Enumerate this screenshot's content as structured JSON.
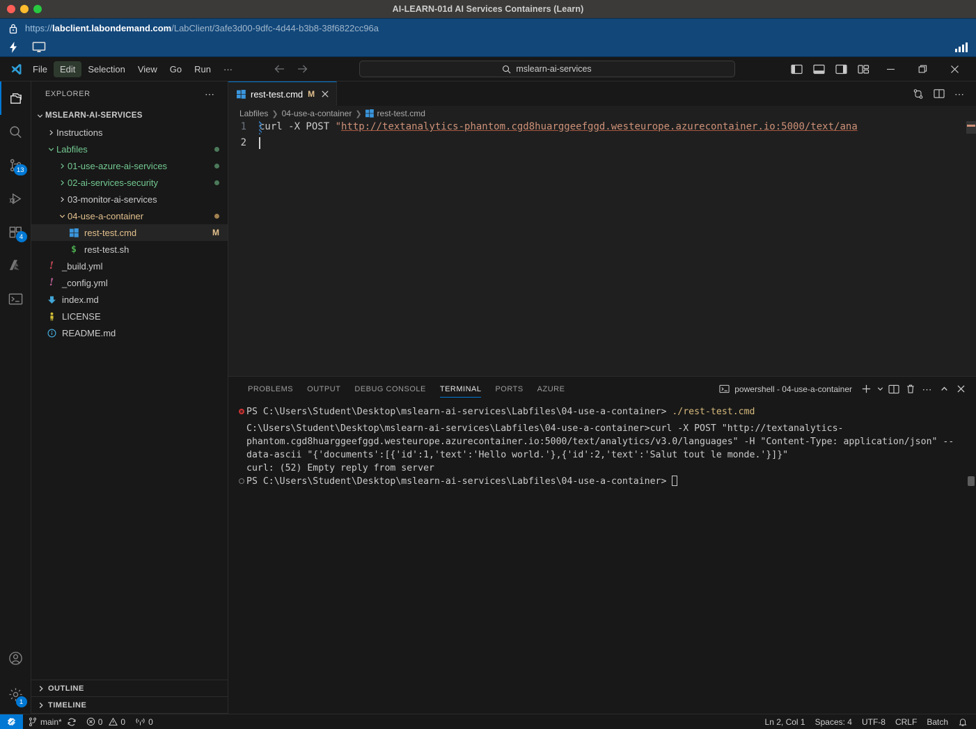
{
  "host": {
    "window_title": "AI-LEARN-01d AI Services Containers (Learn)",
    "url_scheme": "https://",
    "url_host": "labclient.labondemand.com",
    "url_path": "/LabClient/3afe3d00-9dfc-4d44-b3b8-38f6822cc96a"
  },
  "menubar": {
    "items": [
      {
        "label": "File",
        "active": false
      },
      {
        "label": "Edit",
        "active": true
      },
      {
        "label": "Selection",
        "active": false
      },
      {
        "label": "View",
        "active": false
      },
      {
        "label": "Go",
        "active": false
      },
      {
        "label": "Run",
        "active": false
      },
      {
        "label": "···",
        "active": false
      }
    ]
  },
  "quick_search": {
    "value": "mslearn-ai-services"
  },
  "activitybar": {
    "items": [
      {
        "name": "explorer",
        "badge": ""
      },
      {
        "name": "search",
        "badge": ""
      },
      {
        "name": "source-control",
        "badge": "13"
      },
      {
        "name": "run-and-debug",
        "badge": ""
      },
      {
        "name": "extensions",
        "badge": "4"
      },
      {
        "name": "azure",
        "badge": ""
      },
      {
        "name": "terminal",
        "badge": ""
      }
    ],
    "account_badge": "",
    "settings_badge": "1"
  },
  "sidebar": {
    "title": "EXPLORER",
    "root": "MSLEARN-AI-SERVICES",
    "tree": [
      {
        "label": "Instructions",
        "indent": 1,
        "type": "folder",
        "expanded": false,
        "color": "",
        "git": ""
      },
      {
        "label": "Labfiles",
        "indent": 1,
        "type": "folder",
        "expanded": true,
        "color": "green",
        "git": "green-dot"
      },
      {
        "label": "01-use-azure-ai-services",
        "indent": 2,
        "type": "folder",
        "expanded": false,
        "color": "green",
        "git": "green-dot"
      },
      {
        "label": "02-ai-services-security",
        "indent": 2,
        "type": "folder",
        "expanded": false,
        "color": "green",
        "git": "green-dot"
      },
      {
        "label": "03-monitor-ai-services",
        "indent": 2,
        "type": "folder",
        "expanded": false,
        "color": "",
        "git": ""
      },
      {
        "label": "04-use-a-container",
        "indent": 2,
        "type": "folder",
        "expanded": true,
        "color": "amber",
        "git": "amber-dot"
      },
      {
        "label": "rest-test.cmd",
        "indent": 3,
        "type": "file",
        "icon": "windows-icon",
        "color": "amber",
        "git": "M",
        "selected": true
      },
      {
        "label": "rest-test.sh",
        "indent": 3,
        "type": "file",
        "icon": "shell-icon",
        "color": "",
        "git": ""
      },
      {
        "label": "_build.yml",
        "indent": 1,
        "type": "file",
        "icon": "yaml-icon",
        "color": "",
        "git": ""
      },
      {
        "label": "_config.yml",
        "indent": 1,
        "type": "file",
        "icon": "yaml-icon",
        "color": "",
        "git": ""
      },
      {
        "label": "index.md",
        "indent": 1,
        "type": "file",
        "icon": "markdown-icon",
        "color": "",
        "git": ""
      },
      {
        "label": "LICENSE",
        "indent": 1,
        "type": "file",
        "icon": "license-icon",
        "color": "",
        "git": ""
      },
      {
        "label": "README.md",
        "indent": 1,
        "type": "file",
        "icon": "info-icon",
        "color": "",
        "git": ""
      }
    ],
    "sections": [
      {
        "label": "OUTLINE"
      },
      {
        "label": "TIMELINE"
      }
    ]
  },
  "editor": {
    "tab": {
      "label": "rest-test.cmd",
      "modified_badge": "M"
    },
    "breadcrumb": [
      "Labfiles",
      "04-use-a-container",
      "rest-test.cmd"
    ],
    "lines": [
      {
        "number": "1",
        "prefix": "curl -X POST ",
        "quote": "\"",
        "url": "http://textanalytics-phantom.cgd8huarggeefggd.westeurope.azurecontainer.io:5000/text/ana"
      },
      {
        "number": "2",
        "prefix": "",
        "quote": "",
        "url": ""
      }
    ]
  },
  "panel": {
    "tabs": [
      {
        "label": "PROBLEMS",
        "active": false
      },
      {
        "label": "OUTPUT",
        "active": false
      },
      {
        "label": "DEBUG CONSOLE",
        "active": false
      },
      {
        "label": "TERMINAL",
        "active": true
      },
      {
        "label": "PORTS",
        "active": false
      },
      {
        "label": "AZURE",
        "active": false
      }
    ],
    "terminal_selector": "powershell - 04-use-a-container",
    "terminal_lines": [
      {
        "mark": "err",
        "prompt": "PS C:\\Users\\Student\\Desktop\\mslearn-ai-services\\Labfiles\\04-use-a-container> ",
        "cmd": "./rest-test.cmd",
        "text": ""
      },
      {
        "mark": "",
        "prompt": "",
        "cmd": "",
        "text": ""
      },
      {
        "mark": "",
        "prompt": "",
        "cmd": "",
        "text": "C:\\Users\\Student\\Desktop\\mslearn-ai-services\\Labfiles\\04-use-a-container>curl -X POST \"http://textanalytics-phantom.cgd8huarggeefggd.westeurope.azurecontainer.io:5000/text/analytics/v3.0/languages\" -H \"Content-Type: application/json\" --data-ascii \"{'documents':[{'id':1,'text':'Hello world.'},{'id':2,'text':'Salut tout le monde.'}]}\""
      },
      {
        "mark": "",
        "prompt": "",
        "cmd": "",
        "text": "curl: (52) Empty reply from server"
      },
      {
        "mark": "ok",
        "prompt": "PS C:\\Users\\Student\\Desktop\\mslearn-ai-services\\Labfiles\\04-use-a-container> ",
        "cmd": "",
        "text": "",
        "cursor": true
      }
    ]
  },
  "statusbar": {
    "branch": "main*",
    "errors": "0",
    "warnings": "0",
    "ports": "0",
    "position": "Ln 2, Col 1",
    "indentation": "Spaces: 4",
    "encoding": "UTF-8",
    "eol": "CRLF",
    "language": "Batch"
  },
  "colors": {
    "accent": "#0078d4",
    "modified": "#e2c08d",
    "added": "#73c991",
    "url_bar": "#12477a"
  }
}
